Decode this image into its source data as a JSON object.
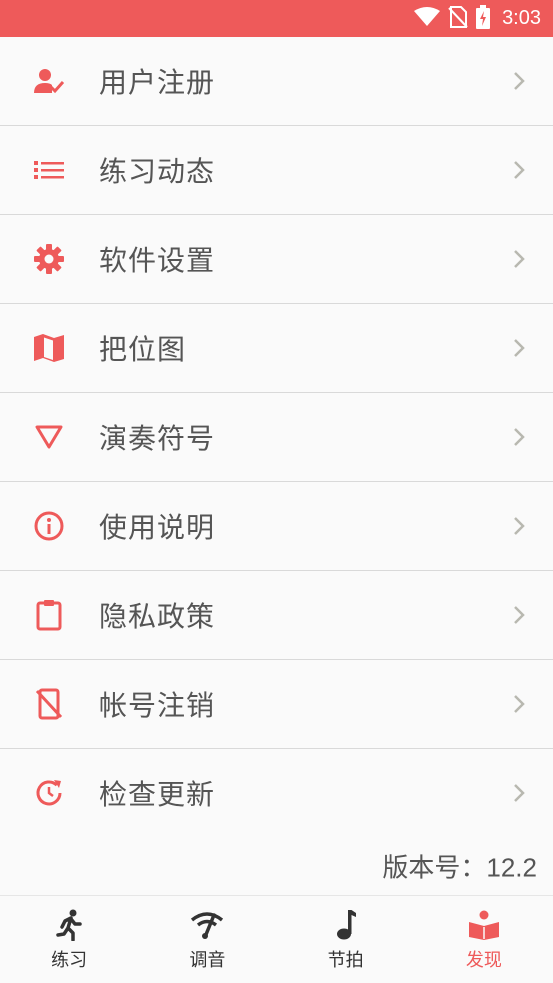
{
  "status_bar": {
    "time": "3:03",
    "bg_color": "#ee5a5a"
  },
  "menu": {
    "items": [
      {
        "label": "用户注册",
        "icon": "user-check-icon"
      },
      {
        "label": "练习动态",
        "icon": "list-icon"
      },
      {
        "label": "软件设置",
        "icon": "gear-icon"
      },
      {
        "label": "把位图",
        "icon": "map-icon"
      },
      {
        "label": "演奏符号",
        "icon": "triangle-down-icon"
      },
      {
        "label": "使用说明",
        "icon": "info-icon"
      },
      {
        "label": "隐私政策",
        "icon": "clipboard-icon"
      },
      {
        "label": "帐号注销",
        "icon": "phone-off-icon"
      },
      {
        "label": "检查更新",
        "icon": "update-icon"
      }
    ]
  },
  "version": {
    "label": "版本号：",
    "value": "12.2"
  },
  "bottom_nav": {
    "items": [
      {
        "label": "练习",
        "icon": "run-icon",
        "active": false
      },
      {
        "label": "调音",
        "icon": "tuner-icon",
        "active": false
      },
      {
        "label": "节拍",
        "icon": "music-note-icon",
        "active": false
      },
      {
        "label": "发现",
        "icon": "discover-book-icon",
        "active": true
      }
    ]
  },
  "colors": {
    "accent": "#ee5a5a",
    "text": "#555555",
    "chevron": "#b8b8b0"
  }
}
